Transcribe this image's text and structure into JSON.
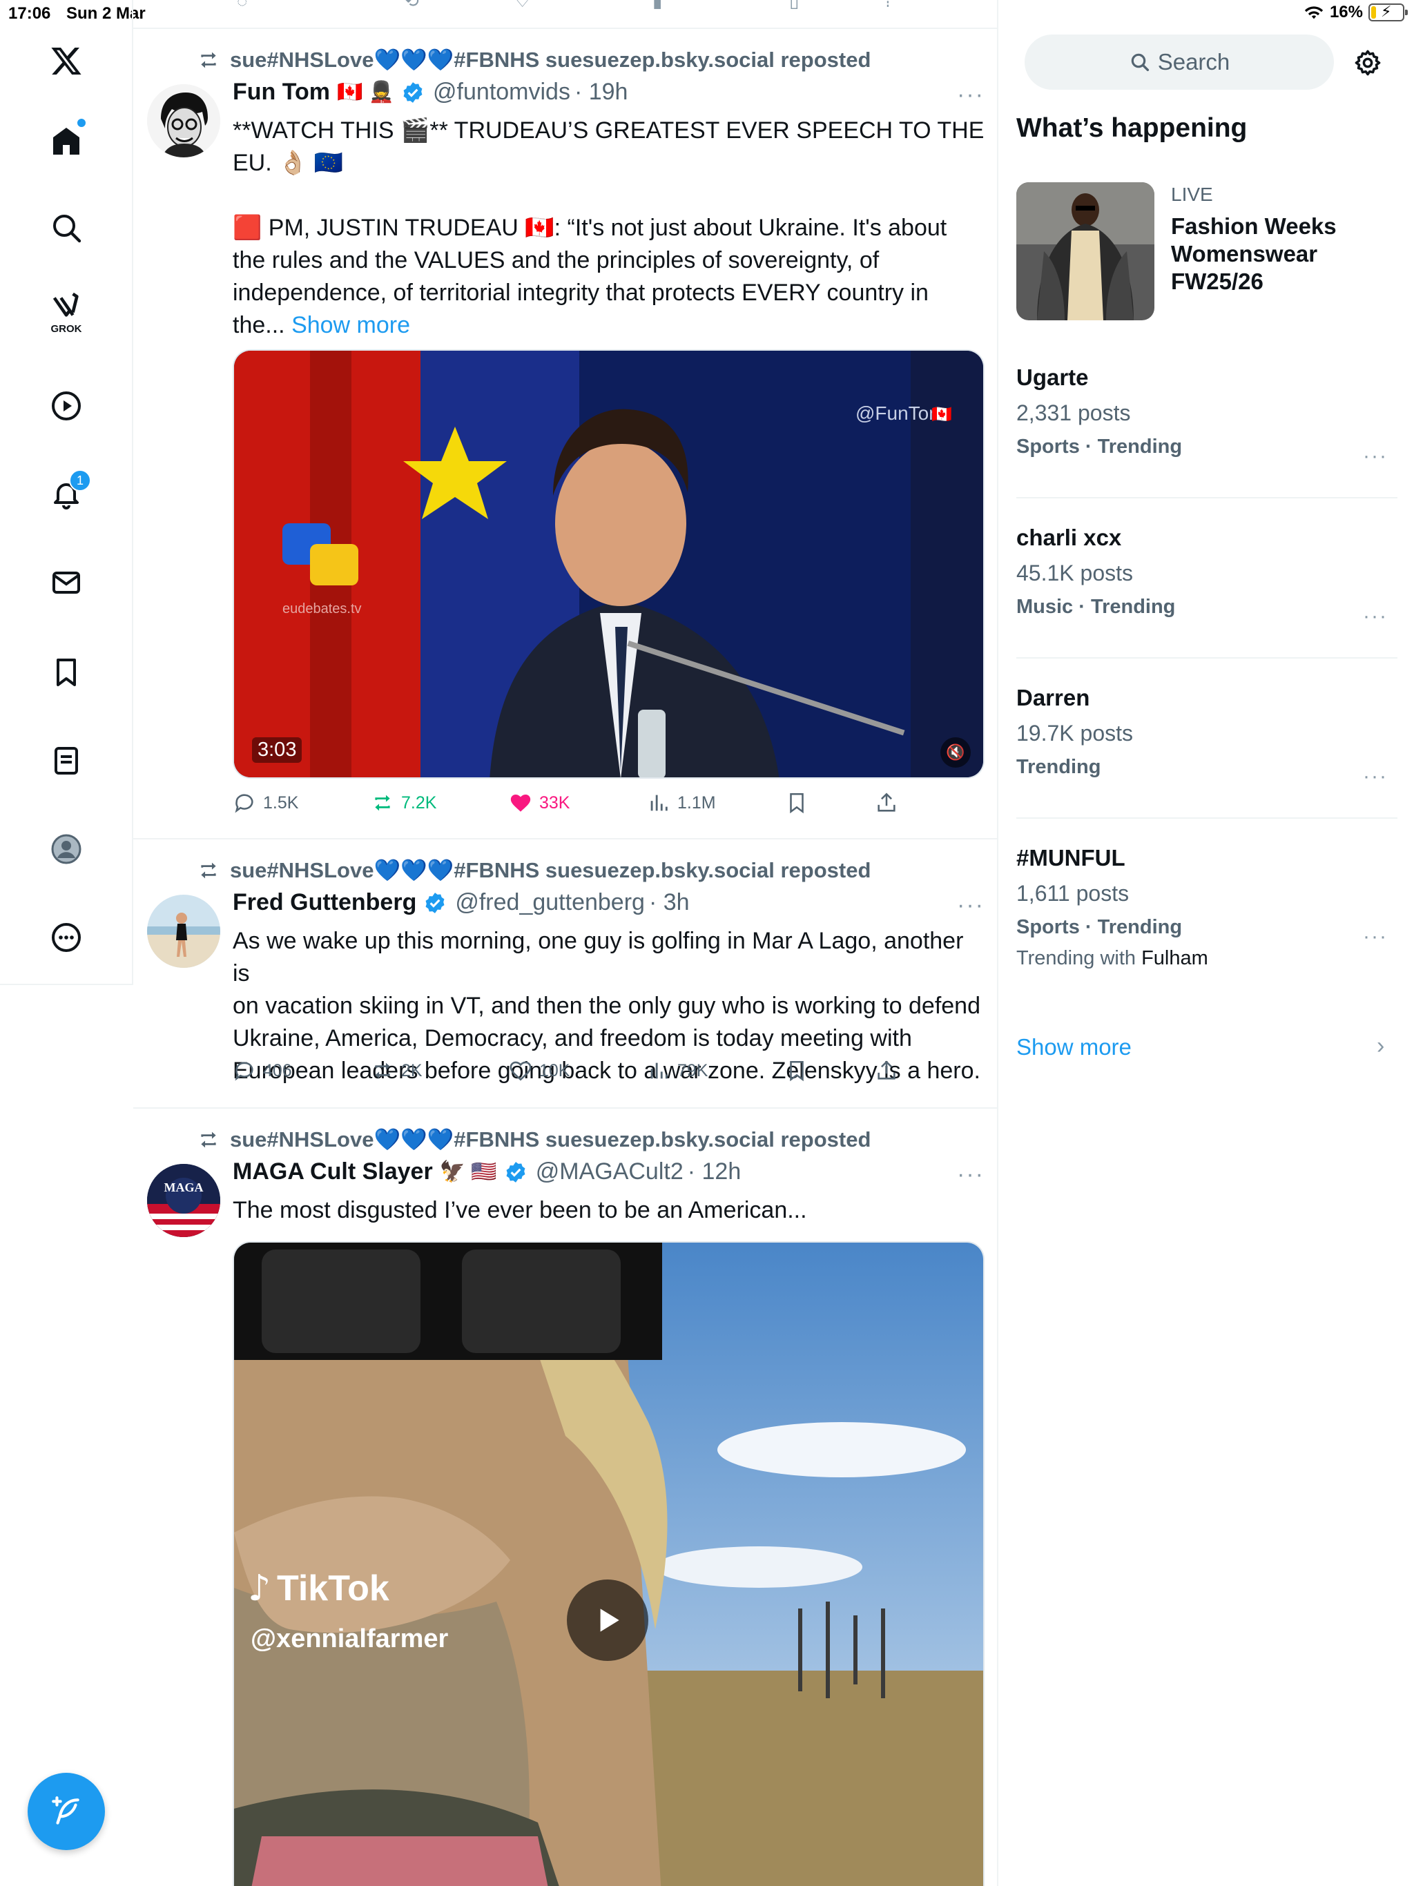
{
  "status_bar": {
    "time": "17:06",
    "date": "Sun 2 Mar",
    "battery": "16%",
    "battery_level": 0.16
  },
  "nav": {
    "grok_label": "GROK",
    "notifications_badge": "1"
  },
  "timeline": {
    "posts": [
      {
        "repost_by": "sue#NHSLove",
        "repost_hearts": "💙💙💙",
        "repost_tail": "#FBNHS suesuezep.bsky.social reposted",
        "name": "Fun Tom",
        "name_emoji": "🇨🇦 💂",
        "handle": "@funtomvids",
        "time": "· 19h",
        "lines": [
          "**WATCH THIS 🎬**   TRUDEAU’S GREATEST EVER SPEECH TO THE",
          "EU. 👌🏼 🇪🇺",
          "",
          "🟥  PM, JUSTIN TRUDEAU 🇨🇦: “It's not just about Ukraine. It's about",
          "the rules and the VALUES and the principles of sovereignty, of",
          "independence, of territorial integrity that protects EVERY country in"
        ],
        "last_line": "the...",
        "show_more": "Show more",
        "video_duration": "3:03",
        "watermark": "@FunTom",
        "watermark_flag": "🇨🇦",
        "eu_label": "eudebates.tv",
        "replies": "1.5K",
        "reposts": "7.2K",
        "likes": "33K",
        "views": "1.1M"
      },
      {
        "repost_by": "sue#NHSLove",
        "repost_hearts": "💙💙💙",
        "repost_tail": "#FBNHS suesuezep.bsky.social reposted",
        "name": "Fred Guttenberg",
        "handle": "@fred_guttenberg",
        "time": "· 3h",
        "lines": [
          "As we wake up this morning, one guy is golfing in Mar A Lago, another is",
          "on vacation skiing in VT, and then the only guy who is working to defend",
          "Ukraine, America, Democracy, and freedom is today meeting with",
          "European leaders before going back to a war zone.  Zelenskyy is a hero."
        ],
        "replies": "406",
        "reposts": "2K",
        "likes": "10K",
        "views": "79K"
      },
      {
        "repost_by": "sue#NHSLove",
        "repost_hearts": "💙💙💙",
        "repost_tail": "#FBNHS suesuezep.bsky.social reposted",
        "name": "MAGA Cult Slayer",
        "name_emoji": "🦅 🇺🇸",
        "handle": "@MAGACult2",
        "time": "· 12h",
        "lines": [
          "The most disgusted I’ve ever been to be an American..."
        ],
        "avatar_text": "MAGA",
        "tiktok_label": "TikTok",
        "tiktok_handle": "@xennialfarmer"
      }
    ]
  },
  "sidebar": {
    "search_placeholder": "Search",
    "whats_happening": "What’s happening",
    "live": {
      "tag": "LIVE",
      "title": "Fashion Weeks Womenswear FW25/26"
    },
    "trends": [
      {
        "name": "Ugarte",
        "count": "2,331 posts",
        "category": "Sports · Trending"
      },
      {
        "name": "charli xcx",
        "count": "45.1K posts",
        "category": "Music · Trending"
      },
      {
        "name": "Darren",
        "count": "19.7K posts",
        "category": "Trending"
      },
      {
        "name": "#MUNFUL",
        "count": "1,611 posts",
        "category": "Sports · Trending",
        "with_prefix": "Trending with",
        "with_name": "Fulham"
      }
    ],
    "show_more": "Show more"
  }
}
